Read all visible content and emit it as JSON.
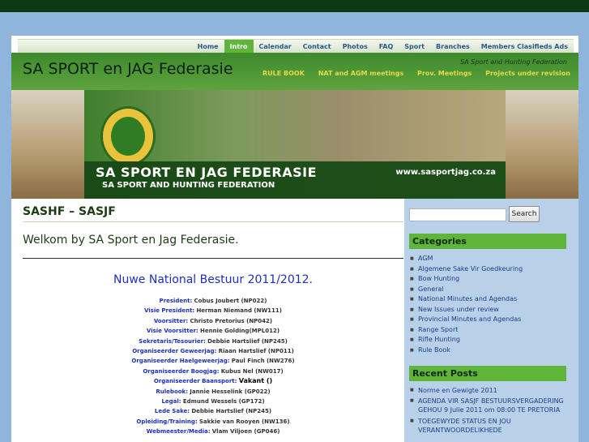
{
  "nav_primary": [
    {
      "label": "Home",
      "active": false
    },
    {
      "label": "Intro",
      "active": true
    },
    {
      "label": "Calendar",
      "active": false
    },
    {
      "label": "Contact",
      "active": false
    },
    {
      "label": "Photos",
      "active": false
    },
    {
      "label": "FAQ",
      "active": false
    },
    {
      "label": "Sport",
      "active": false
    },
    {
      "label": "Branches",
      "active": false
    },
    {
      "label": "Members Clasifieds Ads",
      "active": false
    }
  ],
  "header": {
    "site_title": "SA SPORT en JAG Federasie",
    "tagline": "SA Sport and Hunting Federation"
  },
  "nav_secondary": [
    "RULE BOOK",
    "NAT and AGM meetings",
    "Prov. Meetings",
    "Projects under revision"
  ],
  "banner": {
    "line1": "SA SPORT EN JAG FEDERASIE",
    "line2": "SA SPORT AND HUNTING FEDERATION",
    "url": "www.sasportjag.co.za"
  },
  "post": {
    "title": "SASHF – SASJF",
    "welcome": "Welkom by SA Sport en Jag Federasie.",
    "headline": "Nuwe National Bestuur 2011/2012."
  },
  "roles": [
    {
      "k": "President:",
      "v": "Cobus Joubert (NP022)"
    },
    {
      "k": "Visie President:",
      "v": "Herman Niemand (NW111)"
    },
    {
      "k": "Voorsitter:",
      "v": "Christo Pretorius (NP042)"
    },
    {
      "k": "Visie Voorsitter:",
      "v": "Hennie Golding(MPL012)"
    },
    {
      "k": "Sekretaris/Tesourier:",
      "v": "Debbie Hartslief (NP245)"
    },
    {
      "k": "Organiseerder Geweerjag:",
      "v": "Riaan Hartslief (NP011)"
    },
    {
      "k": "Organiseerder Haelgeweerjag:",
      "v": "Paul Finch (NW276)"
    },
    {
      "k": "Organiseerder Boogjag:",
      "v": "Kubus Nel (NW017)"
    },
    {
      "k": "Organiseerder Baansport:",
      "v": "Vakant ()"
    },
    {
      "k": "Rulebook:",
      "v": "Jannie Hesselink (GP022)"
    },
    {
      "k": "Legal:",
      "v": "Edmund Wessels (GP172)"
    },
    {
      "k": "Lede Sake:",
      "v": "Debbie Hartslief (NP245)"
    },
    {
      "k": "Opleiding/Training:",
      "v": "Sakkie van Rooyen (NW136)"
    },
    {
      "k": "Webmeester/Media:",
      "v": "Vlam Viljoen (GP046)"
    }
  ],
  "sidebar": {
    "search_button": "Search",
    "categories_title": "Categories",
    "categories": [
      "AGM",
      "Algemene Sake Vir Goedkeuring",
      "Bow Hunting",
      "General",
      "National Minutes and Agendas",
      "New Issues under review",
      "Provincial Minutes and Agendas",
      "Range Sport",
      "Rifle Hunting",
      "Rule Book"
    ],
    "recent_title": "Recent Posts",
    "recent": [
      "Norme en Gewigte 2011",
      "AGENDA VIR SASJF BESTUURSVERGADERING GEHOU 9 Julie 2011 om 08:00 TE PRETORIA",
      "TOEGEWYDE STATUS EN JOU VERANTWOORDELIKHEDE"
    ]
  },
  "colors": {
    "accent_green": "#5fb43a",
    "link_blue": "#1c2fbf",
    "sidebar_bg": "#b9d1e8"
  }
}
